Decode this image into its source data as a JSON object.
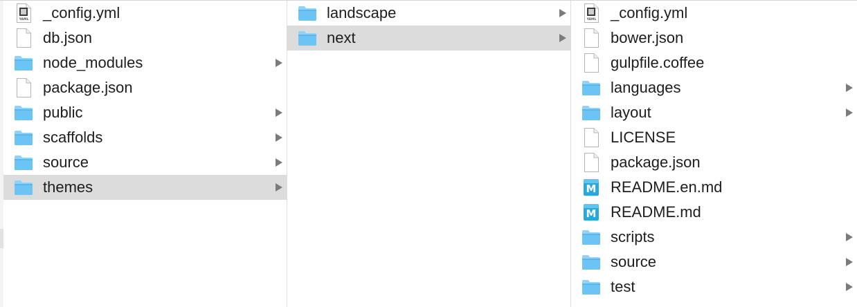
{
  "columns": [
    {
      "items": [
        {
          "label": "_config.yml",
          "icon": "yaml-file-icon",
          "folder": false,
          "selected": false
        },
        {
          "label": "db.json",
          "icon": "document-icon",
          "folder": false,
          "selected": false
        },
        {
          "label": "node_modules",
          "icon": "folder-icon",
          "folder": true,
          "selected": false
        },
        {
          "label": "package.json",
          "icon": "document-icon",
          "folder": false,
          "selected": false
        },
        {
          "label": "public",
          "icon": "folder-icon",
          "folder": true,
          "selected": false
        },
        {
          "label": "scaffolds",
          "icon": "folder-icon",
          "folder": true,
          "selected": false
        },
        {
          "label": "source",
          "icon": "folder-icon",
          "folder": true,
          "selected": false
        },
        {
          "label": "themes",
          "icon": "folder-icon",
          "folder": true,
          "selected": true
        }
      ]
    },
    {
      "items": [
        {
          "label": "landscape",
          "icon": "folder-icon",
          "folder": true,
          "selected": false
        },
        {
          "label": "next",
          "icon": "folder-icon",
          "folder": true,
          "selected": true
        }
      ]
    },
    {
      "items": [
        {
          "label": "_config.yml",
          "icon": "yaml-file-icon",
          "folder": false,
          "selected": false
        },
        {
          "label": "bower.json",
          "icon": "document-icon",
          "folder": false,
          "selected": false
        },
        {
          "label": "gulpfile.coffee",
          "icon": "document-icon",
          "folder": false,
          "selected": false
        },
        {
          "label": "languages",
          "icon": "folder-icon",
          "folder": true,
          "selected": false
        },
        {
          "label": "layout",
          "icon": "folder-icon",
          "folder": true,
          "selected": false
        },
        {
          "label": "LICENSE",
          "icon": "document-icon",
          "folder": false,
          "selected": false
        },
        {
          "label": "package.json",
          "icon": "document-icon",
          "folder": false,
          "selected": false
        },
        {
          "label": "README.en.md",
          "icon": "markdown-file-icon",
          "folder": false,
          "selected": false
        },
        {
          "label": "README.md",
          "icon": "markdown-file-icon",
          "folder": false,
          "selected": false
        },
        {
          "label": "scripts",
          "icon": "folder-icon",
          "folder": true,
          "selected": false
        },
        {
          "label": "source",
          "icon": "folder-icon",
          "folder": true,
          "selected": false
        },
        {
          "label": "test",
          "icon": "folder-icon",
          "folder": true,
          "selected": false
        }
      ]
    }
  ],
  "icon_glyphs": {
    "yaml": "YAML",
    "markdown": "M"
  },
  "colors": {
    "selection": "#dcdcdc",
    "folder_body": "#6cc4f5",
    "folder_tab": "#8fd3fb",
    "markdown_badge": "#29a8e0",
    "chevron": "#7b7b7b",
    "text": "#1d1d1d"
  }
}
